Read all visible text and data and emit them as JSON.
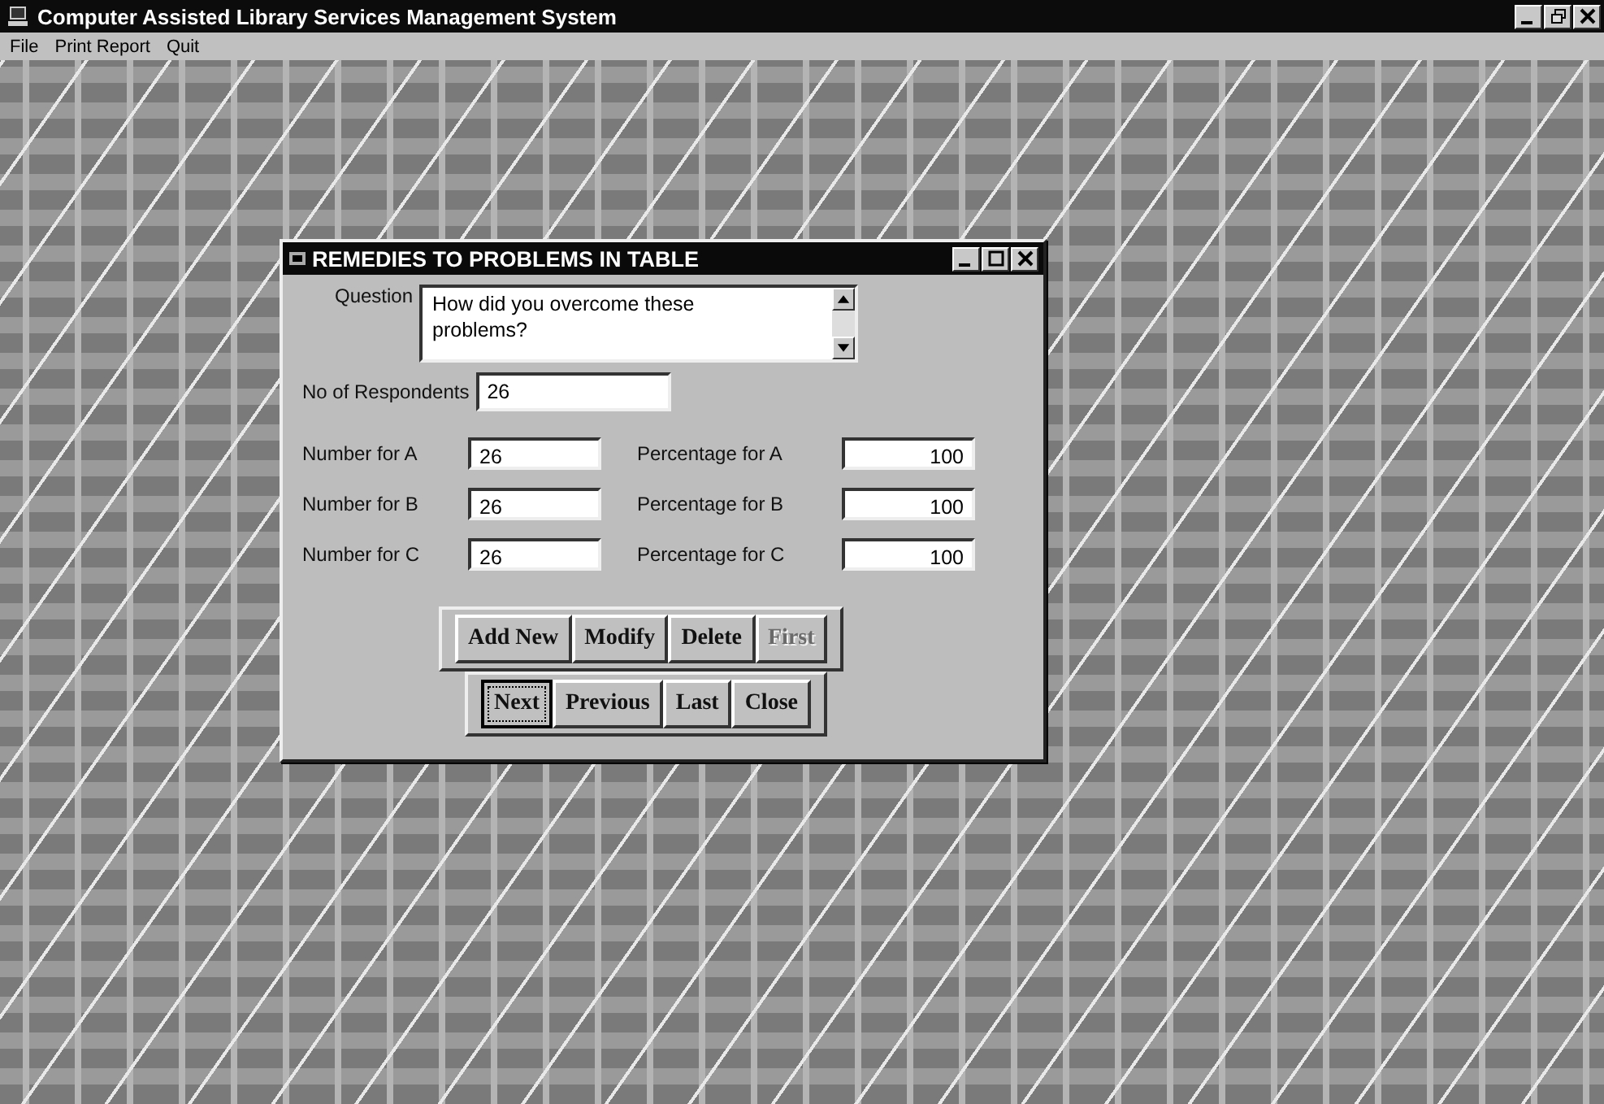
{
  "window": {
    "title": "Computer Assisted Library Services Management System"
  },
  "menu": [
    "File",
    "Print Report",
    "Quit"
  ],
  "dialog": {
    "title": "REMEDIES TO PROBLEMS IN TABLE",
    "question": {
      "label": "Question",
      "value": "How did you overcome these problems?"
    },
    "respondents": {
      "label": "No of Respondents",
      "value": "26"
    },
    "rows": [
      {
        "number_label": "Number for A",
        "number": "26",
        "percent_label": "Percentage  for A",
        "percent": "100"
      },
      {
        "number_label": "Number for B",
        "number": "26",
        "percent_label": "Percentage  for B",
        "percent": "100"
      },
      {
        "number_label": "Number for C",
        "number": "26",
        "percent_label": "Percentage  for C",
        "percent": "100"
      }
    ],
    "button_rows": [
      [
        {
          "label": "Add New",
          "disabled": false,
          "focused": false
        },
        {
          "label": "Modify",
          "disabled": false,
          "focused": false
        },
        {
          "label": "Delete",
          "disabled": false,
          "focused": false
        },
        {
          "label": "First",
          "disabled": true,
          "focused": false
        }
      ],
      [
        {
          "label": "Next",
          "disabled": false,
          "focused": true
        },
        {
          "label": "Previous",
          "disabled": false,
          "focused": false
        },
        {
          "label": "Last",
          "disabled": false,
          "focused": false
        },
        {
          "label": "Close",
          "disabled": false,
          "focused": false
        }
      ]
    ]
  }
}
